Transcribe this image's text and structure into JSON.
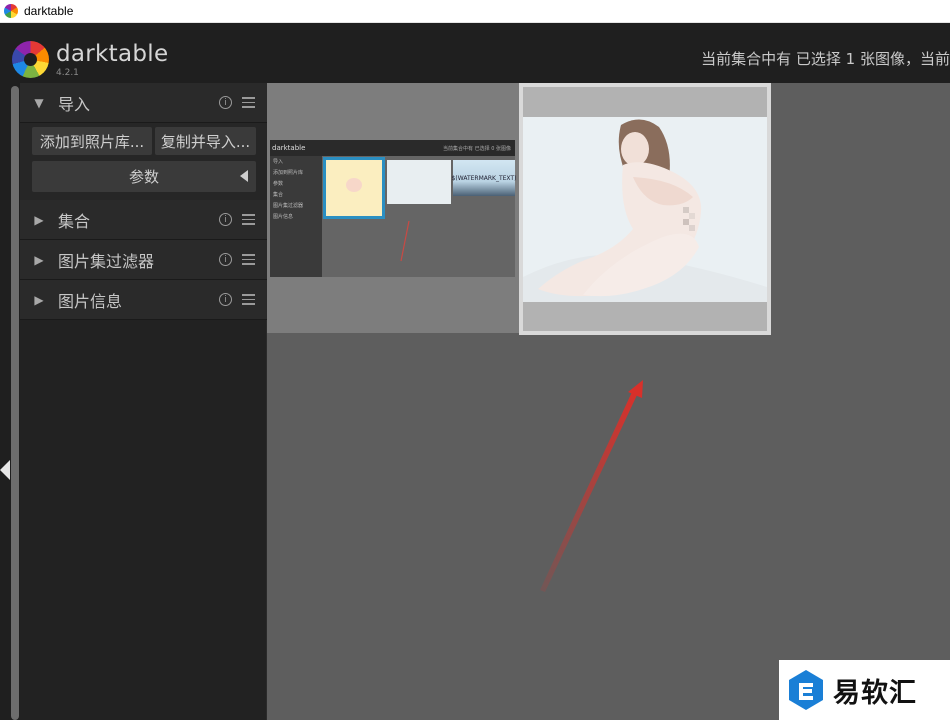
{
  "window": {
    "title": "darktable"
  },
  "header": {
    "brand": "darktable",
    "version": "4.2.1",
    "status": "当前集合中有 已选择 1 张图像，当前"
  },
  "left_panel": {
    "modules": [
      {
        "label": "导入",
        "expanded": true
      },
      {
        "label": "集合",
        "expanded": false
      },
      {
        "label": "图片集过滤器",
        "expanded": false
      },
      {
        "label": "图片信息",
        "expanded": false
      }
    ],
    "import": {
      "add_to_library": "添加到照片库...",
      "copy_and_import": "复制并导入...",
      "parameters": "参数"
    }
  },
  "thumbnails": {
    "mini_preview": {
      "brand": "darktable",
      "status": "当前集合中有 已选择 0 张图像",
      "left_items": [
        "导入",
        "添加到照片库",
        "参数",
        "集合",
        "图片集过滤器",
        "图片信息"
      ],
      "thumb3_text": "$(WATERMARK_TEXT)"
    }
  },
  "watermark": {
    "text": "易软汇"
  },
  "colors": {
    "accent_blue": "#2b8fc2",
    "arrow_red": "#d9302a"
  }
}
